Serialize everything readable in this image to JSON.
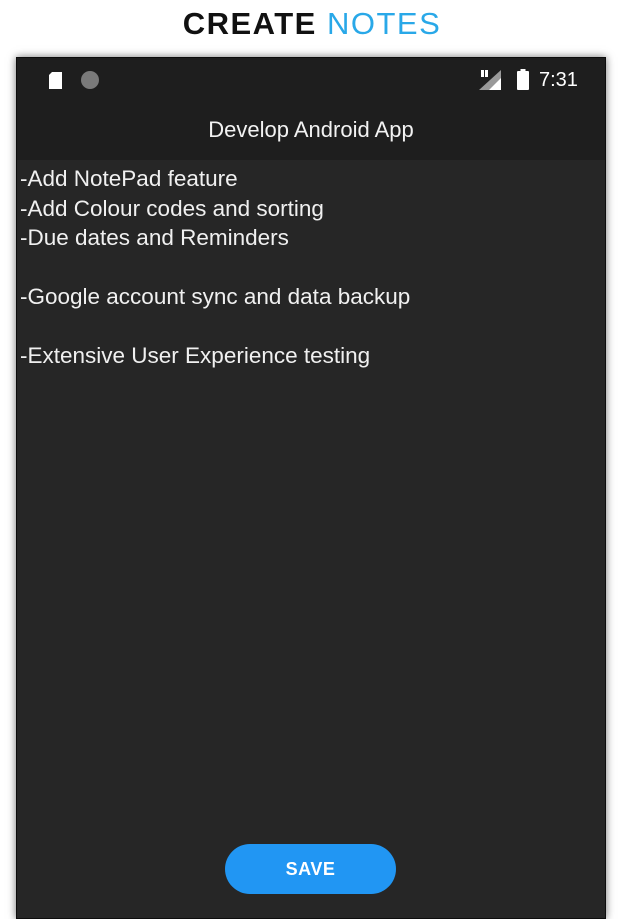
{
  "banner": {
    "word1": "CREATE",
    "word2": "NOTES",
    "word1_color": "#111111",
    "word2_color": "#29a8e8"
  },
  "status_bar": {
    "time": "7:31",
    "icons": [
      "sd-card-icon",
      "circle-notification-icon",
      "signal-icon",
      "battery-icon"
    ]
  },
  "toolbar": {
    "title": "Develop Android App"
  },
  "note": {
    "lines": [
      "-Add NotePad feature",
      "-Add Colour codes and sorting",
      "-Due dates and Reminders",
      "",
      "-Google account sync and data backup",
      "",
      "-Extensive User Experience testing"
    ]
  },
  "save_button": {
    "label": "SAVE",
    "color": "#2196f3"
  },
  "colors": {
    "background": "#262626",
    "bar": "#1e1e1e",
    "text": "#f0f0f0"
  }
}
